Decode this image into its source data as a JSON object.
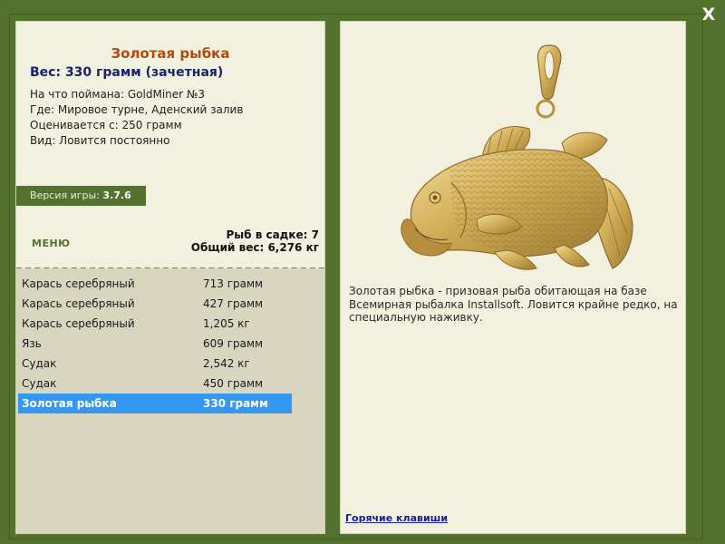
{
  "window": {
    "close_label": "X"
  },
  "fish": {
    "name": "Золотая рыбка",
    "weight_line": "Вес: 330 грамм (зачетная)",
    "details": [
      "На что поймана: GoldMiner №3",
      "Где: Мировое турне, Аденский залив",
      "Оценивается с: 250 грамм",
      "Вид: Ловится постоянно"
    ],
    "description": "Золотая рыбка - призовая рыба обитающая на базе Всемирная рыбалка Installsoft. Ловится крайне редко, на специальную наживку."
  },
  "version": {
    "label": "Версия игры:",
    "value": "3.7.6"
  },
  "menu_label": "МЕНЮ",
  "stats": {
    "count_line": "Рыб в садке: 7",
    "total_line": "Общий вес: 6,276 кг"
  },
  "catch_list": [
    {
      "name": "Карась серебряный",
      "weight": "713 грамм"
    },
    {
      "name": "Карась серебряный",
      "weight": "427 грамм"
    },
    {
      "name": "Карась серебряный",
      "weight": "1,205 кг"
    },
    {
      "name": "Язь",
      "weight": "609 грамм"
    },
    {
      "name": "Судак",
      "weight": "2,542 кг"
    },
    {
      "name": "Судак",
      "weight": "450 грамм"
    },
    {
      "name": "Золотая рыбка",
      "weight": "330 грамм"
    }
  ],
  "hotkeys_label": "Горячие клавиши",
  "colors": {
    "background": "#52722e",
    "panel": "#f2f0df",
    "list_bg": "#d8d6bf",
    "title": "#b24a10",
    "weight": "#1a2270",
    "selection": "#3498f0",
    "link": "#141ea0",
    "gold": "#c9a44c"
  },
  "icons": {
    "close": "close-icon",
    "fish_image": "gold-fish-pendant-image"
  }
}
